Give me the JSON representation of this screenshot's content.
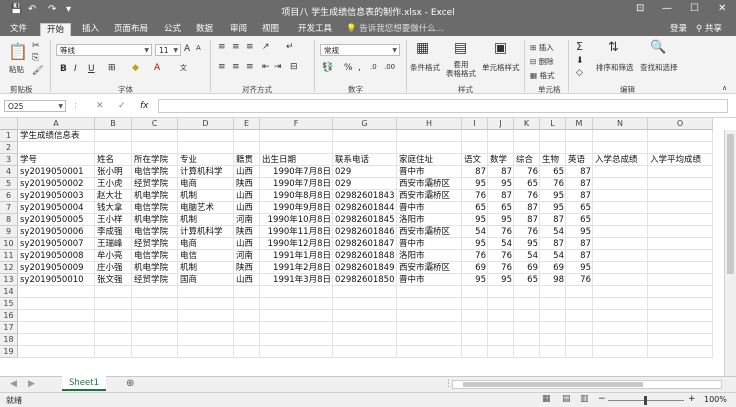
{
  "title_bar": {
    "title": "项目八 学生成绩信息表的制作.xlsx - Excel",
    "qa_save": "💾",
    "qa_undo": "↶",
    "qa_redo": "↷",
    "qa_custom": "▾"
  },
  "window_controls": {
    "ribbon_options": "⊡",
    "minimize": "—",
    "maximize": "☐",
    "close": "✕"
  },
  "tabs": [
    "文件",
    "开始",
    "插入",
    "页面布局",
    "公式",
    "数据",
    "审阅",
    "视图",
    "开发工具"
  ],
  "active_tab": "开始",
  "tell_me": "告诉我您想要做什么...",
  "login": "登录",
  "share": "共享",
  "ribbon": {
    "clipboard": {
      "paste": "粘贴",
      "label": "剪贴板"
    },
    "font": {
      "name": "等线",
      "size": "11",
      "label": "字体",
      "bold": "B",
      "italic": "I",
      "underline": "U"
    },
    "alignment": {
      "label": "对齐方式"
    },
    "number": {
      "format": "常规",
      "label": "数字"
    },
    "styles": {
      "cond": "条件格式",
      "table": "套用\n表格格式",
      "cell": "单元格样式",
      "label": "样式"
    },
    "cells": {
      "insert": "插入",
      "delete": "删除",
      "format": "格式",
      "label": "单元格"
    },
    "editing": {
      "sort": "排序和筛选",
      "find": "查找和选择",
      "label": "编辑"
    }
  },
  "name_box": "O25",
  "formula_icons": {
    "cancel": "✕",
    "enter": "✓",
    "fx": "fx"
  },
  "formula_value": "",
  "columns": [
    "A",
    "B",
    "C",
    "D",
    "E",
    "F",
    "G",
    "H",
    "I",
    "J",
    "K",
    "L",
    "M",
    "N",
    "O"
  ],
  "rows": [
    "1",
    "2",
    "3",
    "4",
    "5",
    "6",
    "7",
    "8",
    "9",
    "10",
    "11",
    "12",
    "13",
    "14",
    "15",
    "16",
    "17",
    "18",
    "19"
  ],
  "cells": {
    "title": "学生成绩信息表",
    "headers": [
      "学号",
      "姓名",
      "所在学院",
      "专业",
      "籍贯",
      "出生日期",
      "联系电话",
      "家庭住址",
      "语文",
      "数学",
      "综合",
      "生物",
      "英语",
      "入学总成绩",
      "入学平均成绩"
    ],
    "data": [
      [
        "sy2019050001",
        "张小明",
        "电信学院",
        "计算机科学",
        "山西",
        "1990年7月8日",
        "029",
        "晋中市",
        "87",
        "87",
        "76",
        "65",
        "87"
      ],
      [
        "sy2019050002",
        "王小虎",
        "经贸学院",
        "电商",
        "陕西",
        "1990年7月8日",
        "029",
        "西安市灞桥区",
        "95",
        "95",
        "65",
        "76",
        "87"
      ],
      [
        "sy2019050003",
        "赵大壮",
        "机电学院",
        "机制",
        "山西",
        "1990年8月8日",
        "02982601843",
        "西安市灞桥区",
        "76",
        "87",
        "76",
        "95",
        "87"
      ],
      [
        "sy2019050004",
        "钱大拿",
        "电信学院",
        "电脑艺术",
        "山西",
        "1990年9月8日",
        "02982601844",
        "晋中市",
        "65",
        "65",
        "87",
        "95",
        "65"
      ],
      [
        "sy2019050005",
        "王小样",
        "机电学院",
        "机制",
        "河南",
        "1990年10月8日",
        "02982601845",
        "洛阳市",
        "95",
        "95",
        "87",
        "87",
        "65"
      ],
      [
        "sy2019050006",
        "李成强",
        "电信学院",
        "计算机科学",
        "陕西",
        "1990年11月8日",
        "02982601846",
        "西安市灞桥区",
        "54",
        "76",
        "76",
        "54",
        "95"
      ],
      [
        "sy2019050007",
        "王瑞峰",
        "经贸学院",
        "电商",
        "山西",
        "1990年12月8日",
        "02982601847",
        "晋中市",
        "95",
        "54",
        "95",
        "87",
        "87"
      ],
      [
        "sy2019050008",
        "牟小亮",
        "电信学院",
        "电信",
        "河南",
        "1991年1月8日",
        "02982601848",
        "洛阳市",
        "76",
        "76",
        "54",
        "54",
        "87"
      ],
      [
        "sy2019050009",
        "庄小强",
        "机电学院",
        "机制",
        "陕西",
        "1991年2月8日",
        "02982601849",
        "西安市灞桥区",
        "69",
        "76",
        "69",
        "69",
        "95"
      ],
      [
        "sy2019050010",
        "张文强",
        "经贸学院",
        "国商",
        "山西",
        "1991年3月8日",
        "02982601850",
        "晋中市",
        "95",
        "95",
        "65",
        "98",
        "76"
      ]
    ]
  },
  "sheet_tabs": [
    "Sheet1"
  ],
  "sheet_nav": {
    "prev": "◀",
    "next": "▶",
    "add": "⊕",
    "more": "⋮"
  },
  "status": {
    "ready": "就绪",
    "zoom": "100%",
    "zoom_minus": "−",
    "zoom_plus": "+"
  }
}
